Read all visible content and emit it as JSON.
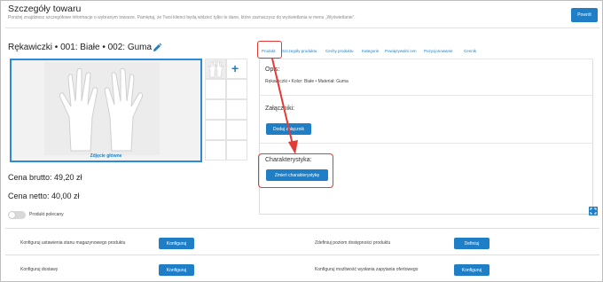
{
  "header": {
    "title": "Szczegóły towaru",
    "subtitle": "Poniżej znajdziesz szczegółowe informacje o wybranym towarze. Pamiętaj, że Twoi klienci będą widzieć tylko te dane, które zaznaczysz do wyświetlania w menu „Wyświetlanie”.",
    "back_label": "Powrót"
  },
  "product": {
    "name": "Rękawiczki • 001: Białe • 002: Guma",
    "main_photo_label": "Zdjęcie główne",
    "price_brutto": "Cena brutto: 49,20 zł",
    "price_netto": "Cena netto: 40,00 zł",
    "recommended_label": "Produkt polecany"
  },
  "tabs": [
    {
      "label": "Produkt"
    },
    {
      "label": "Szczegóły produktu"
    },
    {
      "label": "Cechy produktu"
    },
    {
      "label": "Kategorie"
    },
    {
      "label": "Powiązywalni cen"
    },
    {
      "label": "Pozycjonowanie"
    },
    {
      "label": "Cennik"
    }
  ],
  "panel": {
    "opis_label": "Opis:",
    "opis_text": "Rękawiczki • Kolor: Białe • Materiał: Guma",
    "attachments_label": "Załączniki:",
    "attach_button": "Dodaj załącznik",
    "char_label": "Charakterystyka:",
    "char_button": "Zmień charakterystykę"
  },
  "config_rows": [
    {
      "text": "Konfiguruj ustawienia stanu magazynowego produktu",
      "button": "Konfiguruj"
    },
    {
      "text": "Zdefiniuj poziom dostępności produktu",
      "button": "Definiuj"
    },
    {
      "text": "Konfiguruj dostawy",
      "button": "Konfiguruj"
    },
    {
      "text": "Konfiguruj możliwość wysłania zapytania ofertowego",
      "button": "Konfiguruj"
    }
  ],
  "colors": {
    "accent": "#1e7fc6",
    "highlight": "#e53935"
  },
  "icons": [
    "pencil-icon",
    "plus-icon",
    "fullscreen-icon"
  ]
}
